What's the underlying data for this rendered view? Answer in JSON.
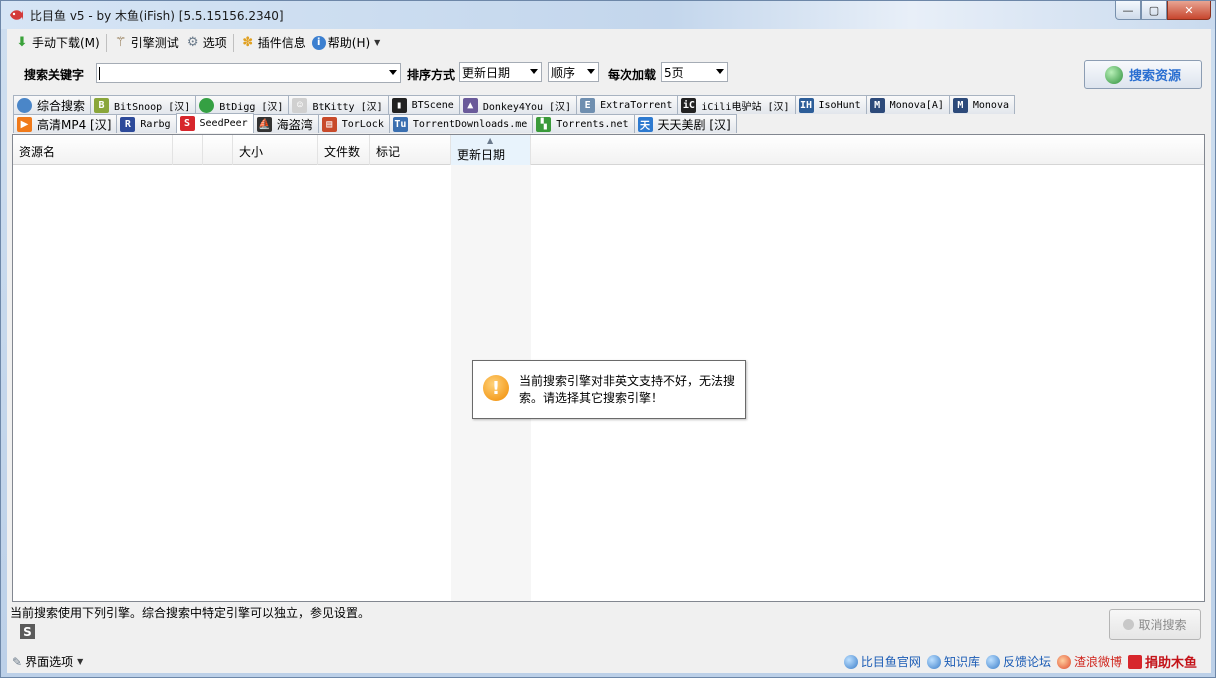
{
  "window": {
    "title": "比目鱼 v5 - by 木鱼(iFish) [5.5.15156.2340]",
    "controls": [
      "minimize",
      "maximize",
      "close"
    ]
  },
  "menu": {
    "items": [
      {
        "label": "手动下载(M)",
        "icon": "download-arrow-icon"
      },
      {
        "label": "引擎测试",
        "icon": "wand-icon"
      },
      {
        "label": "选项",
        "icon": "gear-icon"
      },
      {
        "label": "插件信息",
        "icon": "puzzle-icon"
      },
      {
        "label": "帮助(H)",
        "icon": "info-icon"
      }
    ]
  },
  "search": {
    "keyword_label": "搜索关键字",
    "keyword_value": "",
    "sort_label": "排序方式",
    "sort_field": "更新日期",
    "sort_order": "顺序",
    "load_label": "每次加载",
    "load_value": "5页",
    "search_button": "搜索资源"
  },
  "tabs_row1": [
    {
      "label": "综合搜索",
      "icon_color": "#4a86c8",
      "glyph": ""
    },
    {
      "label": "BitSnoop [汉]",
      "icon_color": "#8aa63a",
      "glyph": "B"
    },
    {
      "label": "BtDigg [汉]",
      "icon_color": "#35a043",
      "glyph": ""
    },
    {
      "label": "BtKitty [汉]",
      "icon_color": "#d0d0d0",
      "glyph": "☺"
    },
    {
      "label": "BTScene",
      "icon_color": "#222222",
      "glyph": "▮"
    },
    {
      "label": "Donkey4You [汉]",
      "icon_color": "#6a5a9a",
      "glyph": "▲"
    },
    {
      "label": "ExtraTorrent",
      "icon_color": "#6f8fb0",
      "glyph": "E"
    },
    {
      "label": "iCili电驴站 [汉]",
      "icon_color": "#222222",
      "glyph": "iC"
    },
    {
      "label": "IsoHunt",
      "icon_color": "#2d5e99",
      "glyph": "IH"
    },
    {
      "label": "Monova[A]",
      "icon_color": "#2d4a7a",
      "glyph": "M"
    },
    {
      "label": "Monova",
      "icon_color": "#2d4a7a",
      "glyph": "M"
    }
  ],
  "tabs_row2": [
    {
      "label": "高清MP4 [汉]",
      "icon_color": "#f07a1a",
      "glyph": "▶"
    },
    {
      "label": "Rarbg",
      "icon_color": "#2d4a9a",
      "glyph": "R"
    },
    {
      "label": "SeedPeer",
      "icon_color": "#d7262c",
      "glyph": "S"
    },
    {
      "label": "海盗湾",
      "icon_color": "#333333",
      "glyph": "⛵"
    },
    {
      "label": "TorLock",
      "icon_color": "#c84a2a",
      "glyph": "▤"
    },
    {
      "label": "TorrentDownloads.me",
      "icon_color": "#3a6fb0",
      "glyph": "Tu"
    },
    {
      "label": "Torrents.net",
      "icon_color": "#3a9a3a",
      "glyph": "▚"
    },
    {
      "label": "天天美剧 [汉]",
      "icon_color": "#2d7ad0",
      "glyph": "天"
    }
  ],
  "active_tab": "SeedPeer",
  "columns": [
    "资源名",
    "",
    "",
    "大小",
    "文件数",
    "标记",
    "更新日期"
  ],
  "popup": {
    "message": "当前搜索引擎对非英文支持不好，无法搜索。请选择其它搜索引擎！"
  },
  "status": {
    "text": "当前搜索使用下列引擎。综合搜索中特定引擎可以独立，参见设置。",
    "engine_glyph": "S",
    "cancel_button": "取消搜索"
  },
  "footer": {
    "ui_options": "界面选项",
    "links": [
      "比目鱼官网",
      "知识库",
      "反馈论坛",
      "渣浪微博",
      "捐助木鱼"
    ]
  }
}
